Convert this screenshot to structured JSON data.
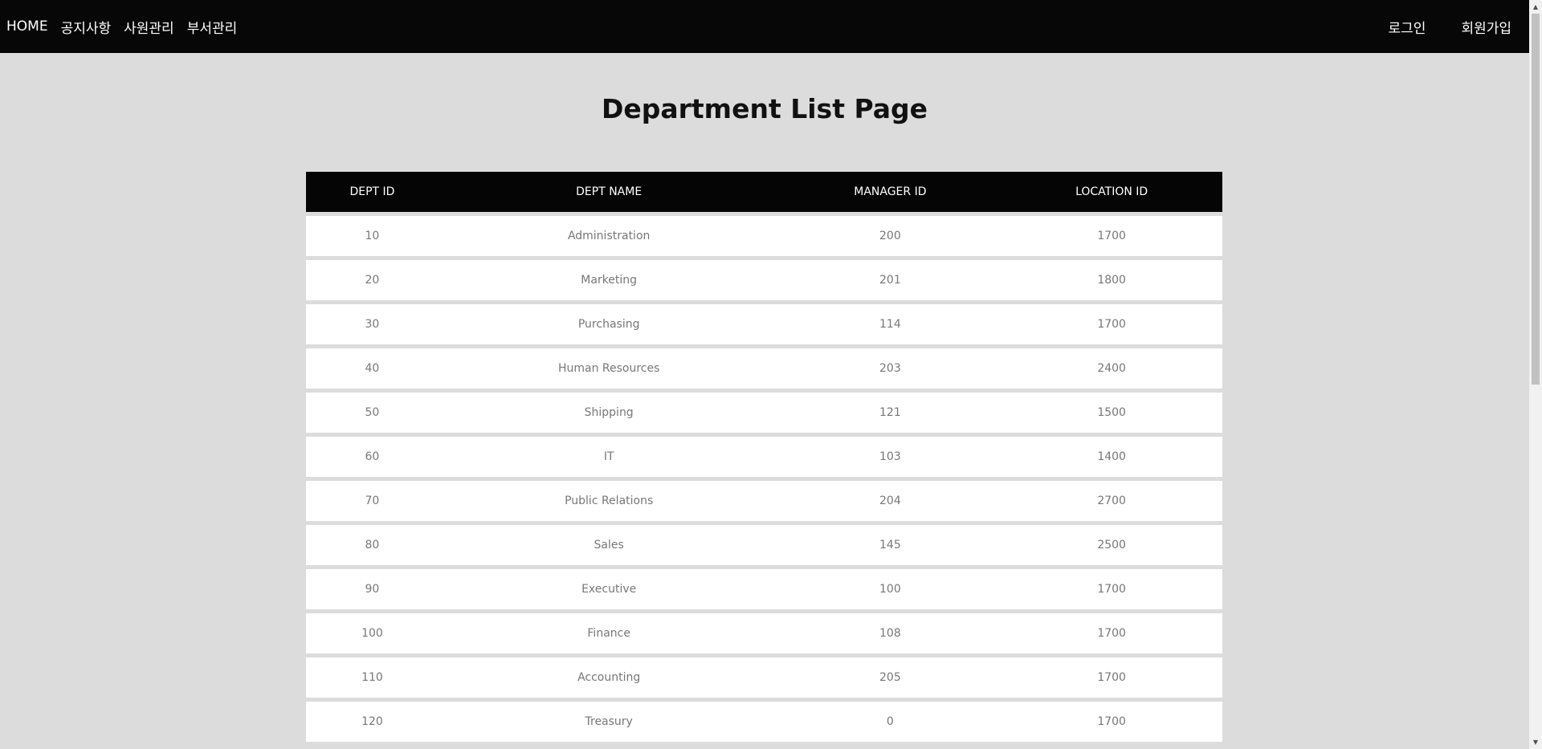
{
  "nav": {
    "left": [
      "HOME",
      "공지사항",
      "사원관리",
      "부서관리"
    ],
    "login": "로그인",
    "signup": "회원가입"
  },
  "page_title": "Department List Page",
  "table": {
    "headers": [
      "DEPT ID",
      "DEPT NAME",
      "MANAGER ID",
      "LOCATION ID"
    ],
    "rows": [
      [
        "10",
        "Administration",
        "200",
        "1700"
      ],
      [
        "20",
        "Marketing",
        "201",
        "1800"
      ],
      [
        "30",
        "Purchasing",
        "114",
        "1700"
      ],
      [
        "40",
        "Human Resources",
        "203",
        "2400"
      ],
      [
        "50",
        "Shipping",
        "121",
        "1500"
      ],
      [
        "60",
        "IT",
        "103",
        "1400"
      ],
      [
        "70",
        "Public Relations",
        "204",
        "2700"
      ],
      [
        "80",
        "Sales",
        "145",
        "2500"
      ],
      [
        "90",
        "Executive",
        "100",
        "1700"
      ],
      [
        "100",
        "Finance",
        "108",
        "1700"
      ],
      [
        "110",
        "Accounting",
        "205",
        "1700"
      ],
      [
        "120",
        "Treasury",
        "0",
        "1700"
      ]
    ]
  },
  "scrollbar": {
    "up_icon": "triangle-up-icon",
    "down_icon": "triangle-down-icon"
  }
}
